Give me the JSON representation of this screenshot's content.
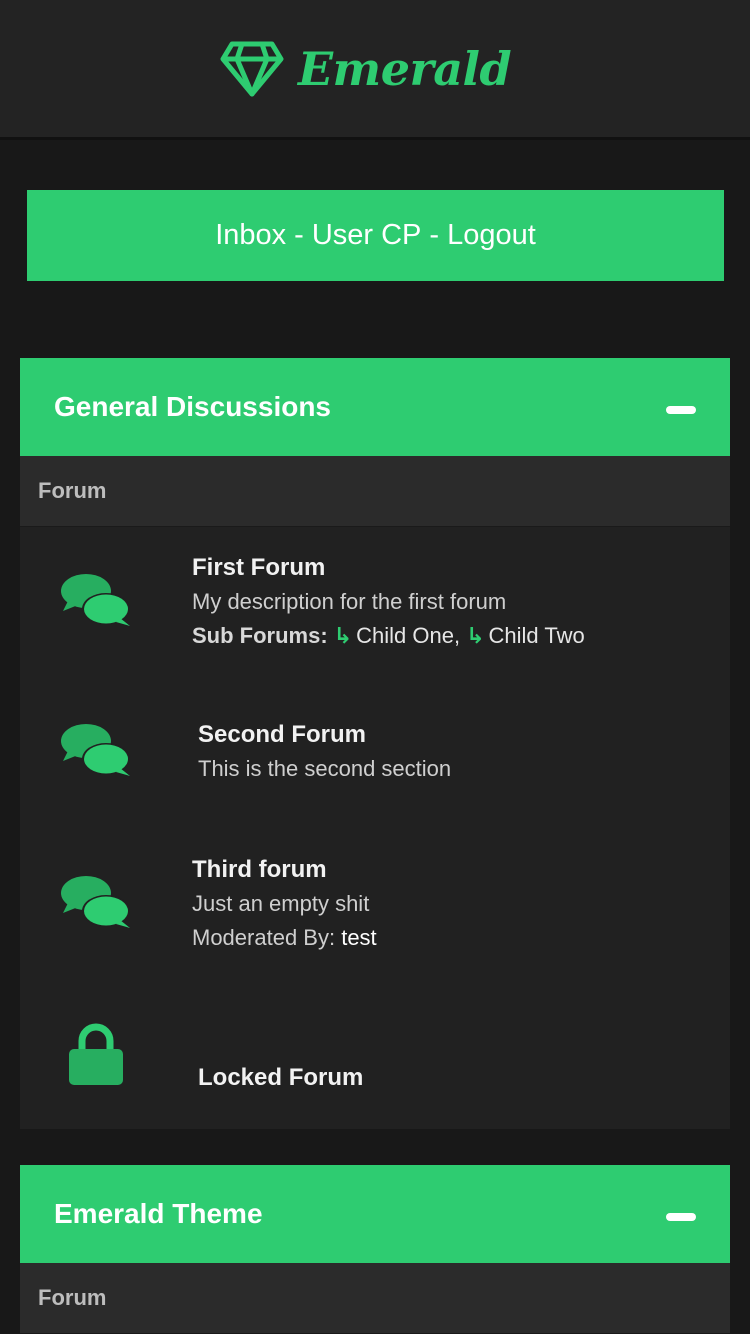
{
  "header": {
    "site_name": "Emerald",
    "logo_icon": "diamond-icon"
  },
  "user_nav": {
    "inbox": "Inbox",
    "user_cp": "User CP",
    "logout": "Logout",
    "separator": "-"
  },
  "colors": {
    "accent": "#2ecc71",
    "background": "#181818",
    "panel": "#212121",
    "header_bg": "#232323"
  },
  "categories": [
    {
      "title": "General Discussions",
      "column_label": "Forum",
      "forums": [
        {
          "name": "First Forum",
          "description": "My description for the first forum",
          "icon": "chat-bubbles-icon",
          "sub_forums_label": "Sub Forums:",
          "sub_forums": [
            "Child One,",
            "Child Two"
          ]
        },
        {
          "name": "Second Forum",
          "description": "This is the second section",
          "icon": "chat-bubbles-icon"
        },
        {
          "name": "Third forum",
          "description": "Just an empty shit",
          "icon": "chat-bubbles-icon",
          "moderated_label": "Moderated By:",
          "moderator": "test"
        },
        {
          "name": "Locked Forum",
          "icon": "lock-icon"
        }
      ]
    },
    {
      "title": "Emerald Theme",
      "column_label": "Forum"
    }
  ]
}
